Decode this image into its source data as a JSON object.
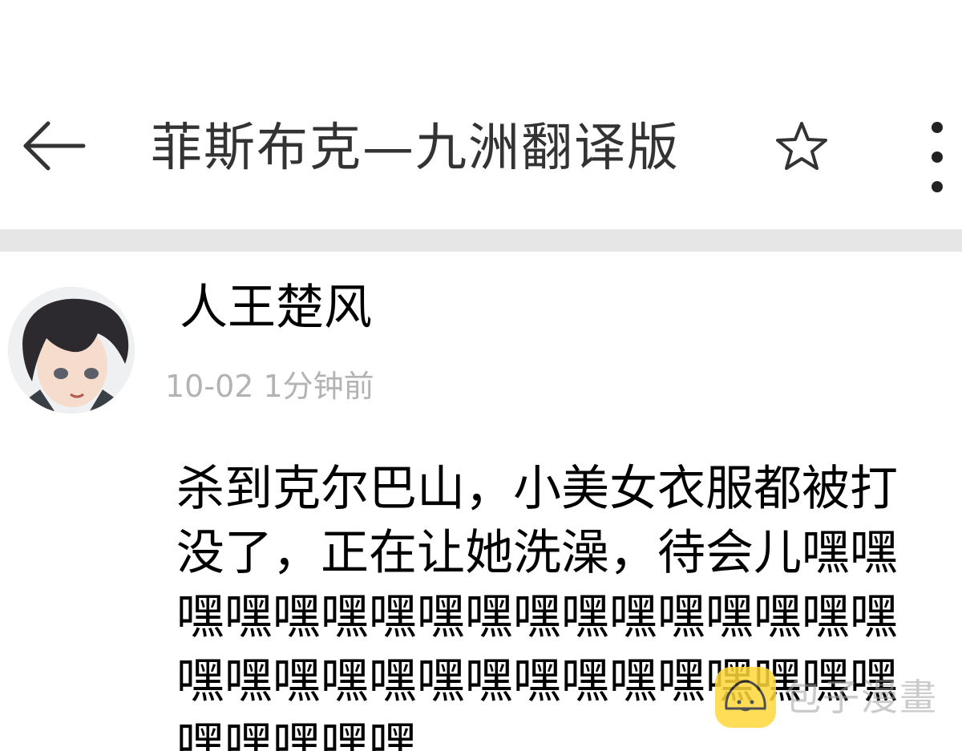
{
  "header": {
    "title": "菲斯布克—九洲翻译版",
    "back_icon": "arrow-left-icon",
    "star_icon": "star-outline-icon",
    "more_icon": "more-vertical-icon"
  },
  "comment": {
    "username": "人王楚风",
    "timestamp": "10-02 1分钟前",
    "text": "杀到克尔巴山，小美女衣服都被打没了，正在让她洗澡，待会儿嘿嘿嘿嘿嘿嘿嘿嘿嘿嘿嘿嘿嘿嘿嘿嘿嘿嘿嘿嘿嘿嘿嘿嘿嘿嘿嘿嘿嘿嘿嘿嘿嘿嘿嘿嘿嘿"
  },
  "watermark": {
    "text": "包子漫畫",
    "icon": "bun-logo-icon",
    "color": "#ffd83a"
  },
  "colors": {
    "divider": "#e6e6e6",
    "timestamp": "#b3b3b3",
    "title": "#333333"
  }
}
